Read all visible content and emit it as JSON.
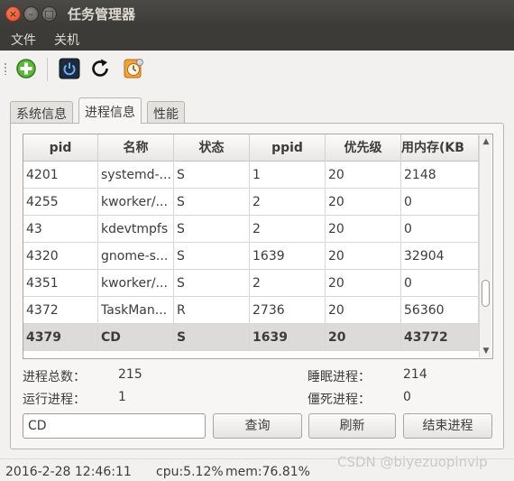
{
  "window": {
    "title": "任务管理器",
    "close_glyph": "×",
    "minimize_glyph": "–",
    "maximize_glyph": "□"
  },
  "menu": {
    "items": [
      "文件",
      "关机"
    ]
  },
  "toolbar": {
    "buttons": [
      {
        "name": "add-process-icon",
        "color": "#4aa330"
      },
      {
        "name": "power-icon",
        "color": "#1d3f66"
      },
      {
        "name": "refresh-icon",
        "color": "#000000"
      },
      {
        "name": "clock-icon",
        "color": "#e08a2a"
      }
    ]
  },
  "tabs": [
    {
      "label": "系统信息",
      "active": false
    },
    {
      "label": "进程信息",
      "active": true
    },
    {
      "label": "性能",
      "active": false
    }
  ],
  "table": {
    "columns": [
      "pid",
      "名称",
      "状态",
      "ppid",
      "优先级",
      "占用内存(KB"
    ],
    "rows": [
      [
        "4201",
        "systemd-...",
        "S",
        "1",
        "20",
        "2148"
      ],
      [
        "4255",
        "kworker/...",
        "S",
        "2",
        "20",
        "0"
      ],
      [
        "43",
        "kdevtmpfs",
        "S",
        "2",
        "20",
        "0"
      ],
      [
        "4320",
        "gnome-s...",
        "S",
        "1639",
        "20",
        "32904"
      ],
      [
        "4351",
        "kworker/...",
        "S",
        "2",
        "20",
        "0"
      ],
      [
        "4372",
        "TaskMan...",
        "R",
        "2736",
        "20",
        "56360"
      ],
      [
        "4379",
        "CD",
        "S",
        "1639",
        "20",
        "43772"
      ]
    ],
    "selected_row": 6
  },
  "stats": {
    "total_label": "进程总数：",
    "total_value": "215",
    "running_label": "运行进程：",
    "running_value": "1",
    "sleeping_label": "睡眠进程：",
    "sleeping_value": "214",
    "zombie_label": "僵死进程：",
    "zombie_value": "0"
  },
  "search": {
    "value": "CD"
  },
  "buttons": {
    "query": "查询",
    "refresh": "刷新",
    "kill": "结束进程"
  },
  "status": {
    "datetime": "2016-2-28 12:46:11",
    "cpu": "cpu:5.12%",
    "mem": "mem:76.81%"
  },
  "watermark": "CSDN @biyezuopinvip"
}
